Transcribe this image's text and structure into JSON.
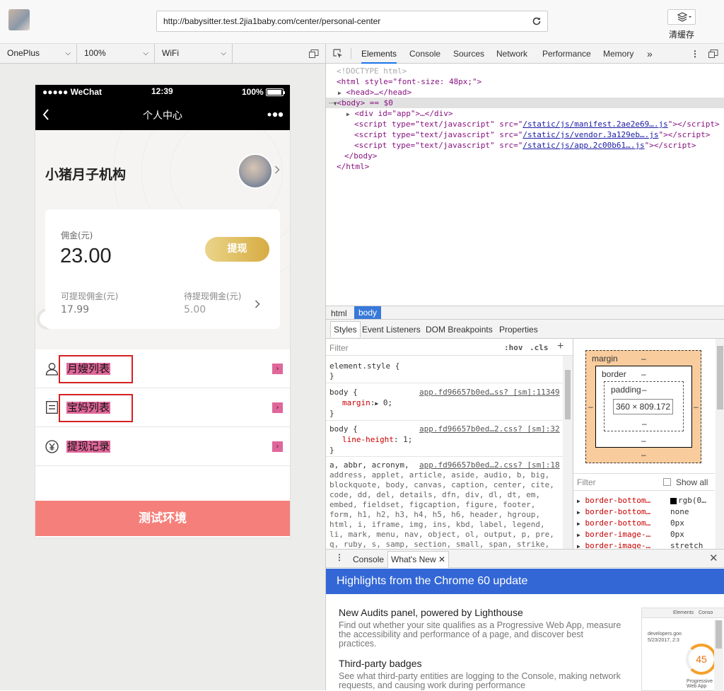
{
  "browser": {
    "url": "http://babysitter.test.2jia1baby.com/center/personal-center",
    "clear_cache_label": "清缓存"
  },
  "device_toolbar": {
    "device": "OnePlus",
    "zoom": "100%",
    "network": "WiFi"
  },
  "phone": {
    "status": {
      "carrier": "●●●●● WeChat",
      "time": "12:39",
      "battery": "100%"
    },
    "nav_title": "个人中心",
    "org_name": "小猪月子机构",
    "card": {
      "commission_label": "佣金(元)",
      "commission_value": "23.00",
      "withdraw_button": "提现",
      "available_label": "可提现佣金(元)",
      "available_value": "17.99",
      "pending_label": "待提现佣金(元)",
      "pending_value": "5.00"
    },
    "menu": [
      {
        "label": "月嫂列表",
        "icon": "person-icon"
      },
      {
        "label": "宝妈列表",
        "icon": "list-icon"
      },
      {
        "label": "提现记录",
        "icon": "yen-icon"
      }
    ],
    "footer": "测试环境"
  },
  "devtools": {
    "tabs": [
      "Elements",
      "Console",
      "Sources",
      "Network",
      "Performance",
      "Memory"
    ],
    "active_tab": "Elements",
    "dom": [
      "<!DOCTYPE html>",
      "<html style=\"font-size: 48px;\">",
      "<head>…</head>",
      "<body> == $0",
      "<div id=\"app\">…</div>",
      "<script type=\"text/javascript\" src=\"",
      "/static/js/manifest.2ae2e69….js",
      "/static/js/vendor.3a129eb….js",
      "/static/js/app.2c00b61….js",
      "</body>",
      "</html>"
    ],
    "crumbs": [
      "html",
      "body"
    ],
    "subtabs": [
      "Styles",
      "Event Listeners",
      "DOM Breakpoints",
      "Properties"
    ],
    "filter_placeholder": "Filter",
    "hov": ":hov",
    "cls": ".cls",
    "styles": {
      "element_style": "element.style {",
      "rule1_selector": "body {",
      "rule1_source": "app.fd96657b0ed…ss? [sm]:11349",
      "rule1_prop": "margin",
      "rule1_val": "0;",
      "rule2_selector": "body {",
      "rule2_source": "app.fd96657b0ed…2.css? [sm]:32",
      "rule2_prop": "line-height",
      "rule2_val": "1;",
      "rule3_source": "app.fd96657b0ed…2.css? [sm]:18",
      "rule3_lines": [
        "a, abbr, acronym,",
        "address, applet, article, aside, audio, b, big,",
        "blockquote, body, canvas, caption, center, cite,",
        "code, dd, del, details, dfn, div, dl, dt, em,",
        "embed, fieldset, figcaption, figure, footer,",
        "form, h1, h2, h3, h4, h5, h6, header, hgroup,",
        "html, i, iframe, img, ins, kbd, label, legend,",
        "li, mark, menu, nav, object, ol, output, p, pre,",
        "q, ruby, s, samp, section, small, span, strike,"
      ]
    },
    "boxmodel": {
      "margin": "margin",
      "border": "border",
      "padding": "padding",
      "dash": "–",
      "content": "360 × 809.172"
    },
    "computed": {
      "filter": "Filter",
      "show_all": "Show all",
      "rows": [
        {
          "prop": "border-bottom…",
          "val": "rgb(0…"
        },
        {
          "prop": "border-bottom…",
          "val": "none"
        },
        {
          "prop": "border-bottom…",
          "val": "0px"
        },
        {
          "prop": "border-image-…",
          "val": "0px"
        },
        {
          "prop": "border-image-…",
          "val": "stretch"
        }
      ]
    },
    "drawer": {
      "tabs": [
        "Console",
        "What's New"
      ],
      "banner": "Highlights from the Chrome 60 update",
      "items": [
        {
          "title": "New Audits panel, powered by Lighthouse",
          "desc": "Find out whether your site qualifies as a Progressive Web App, measure the accessibility and performance of a page, and discover best practices."
        },
        {
          "title": "Third-party badges",
          "desc": "See what third-party entities are logging to the Console, making network requests, and causing work during performance"
        }
      ],
      "thumb": {
        "tab": "Elements",
        "tab2": "Conso",
        "url": "developers.goo",
        "date": "5/23/2017, 2:3",
        "score": "45",
        "pwa": "Progressive Web App"
      }
    }
  }
}
